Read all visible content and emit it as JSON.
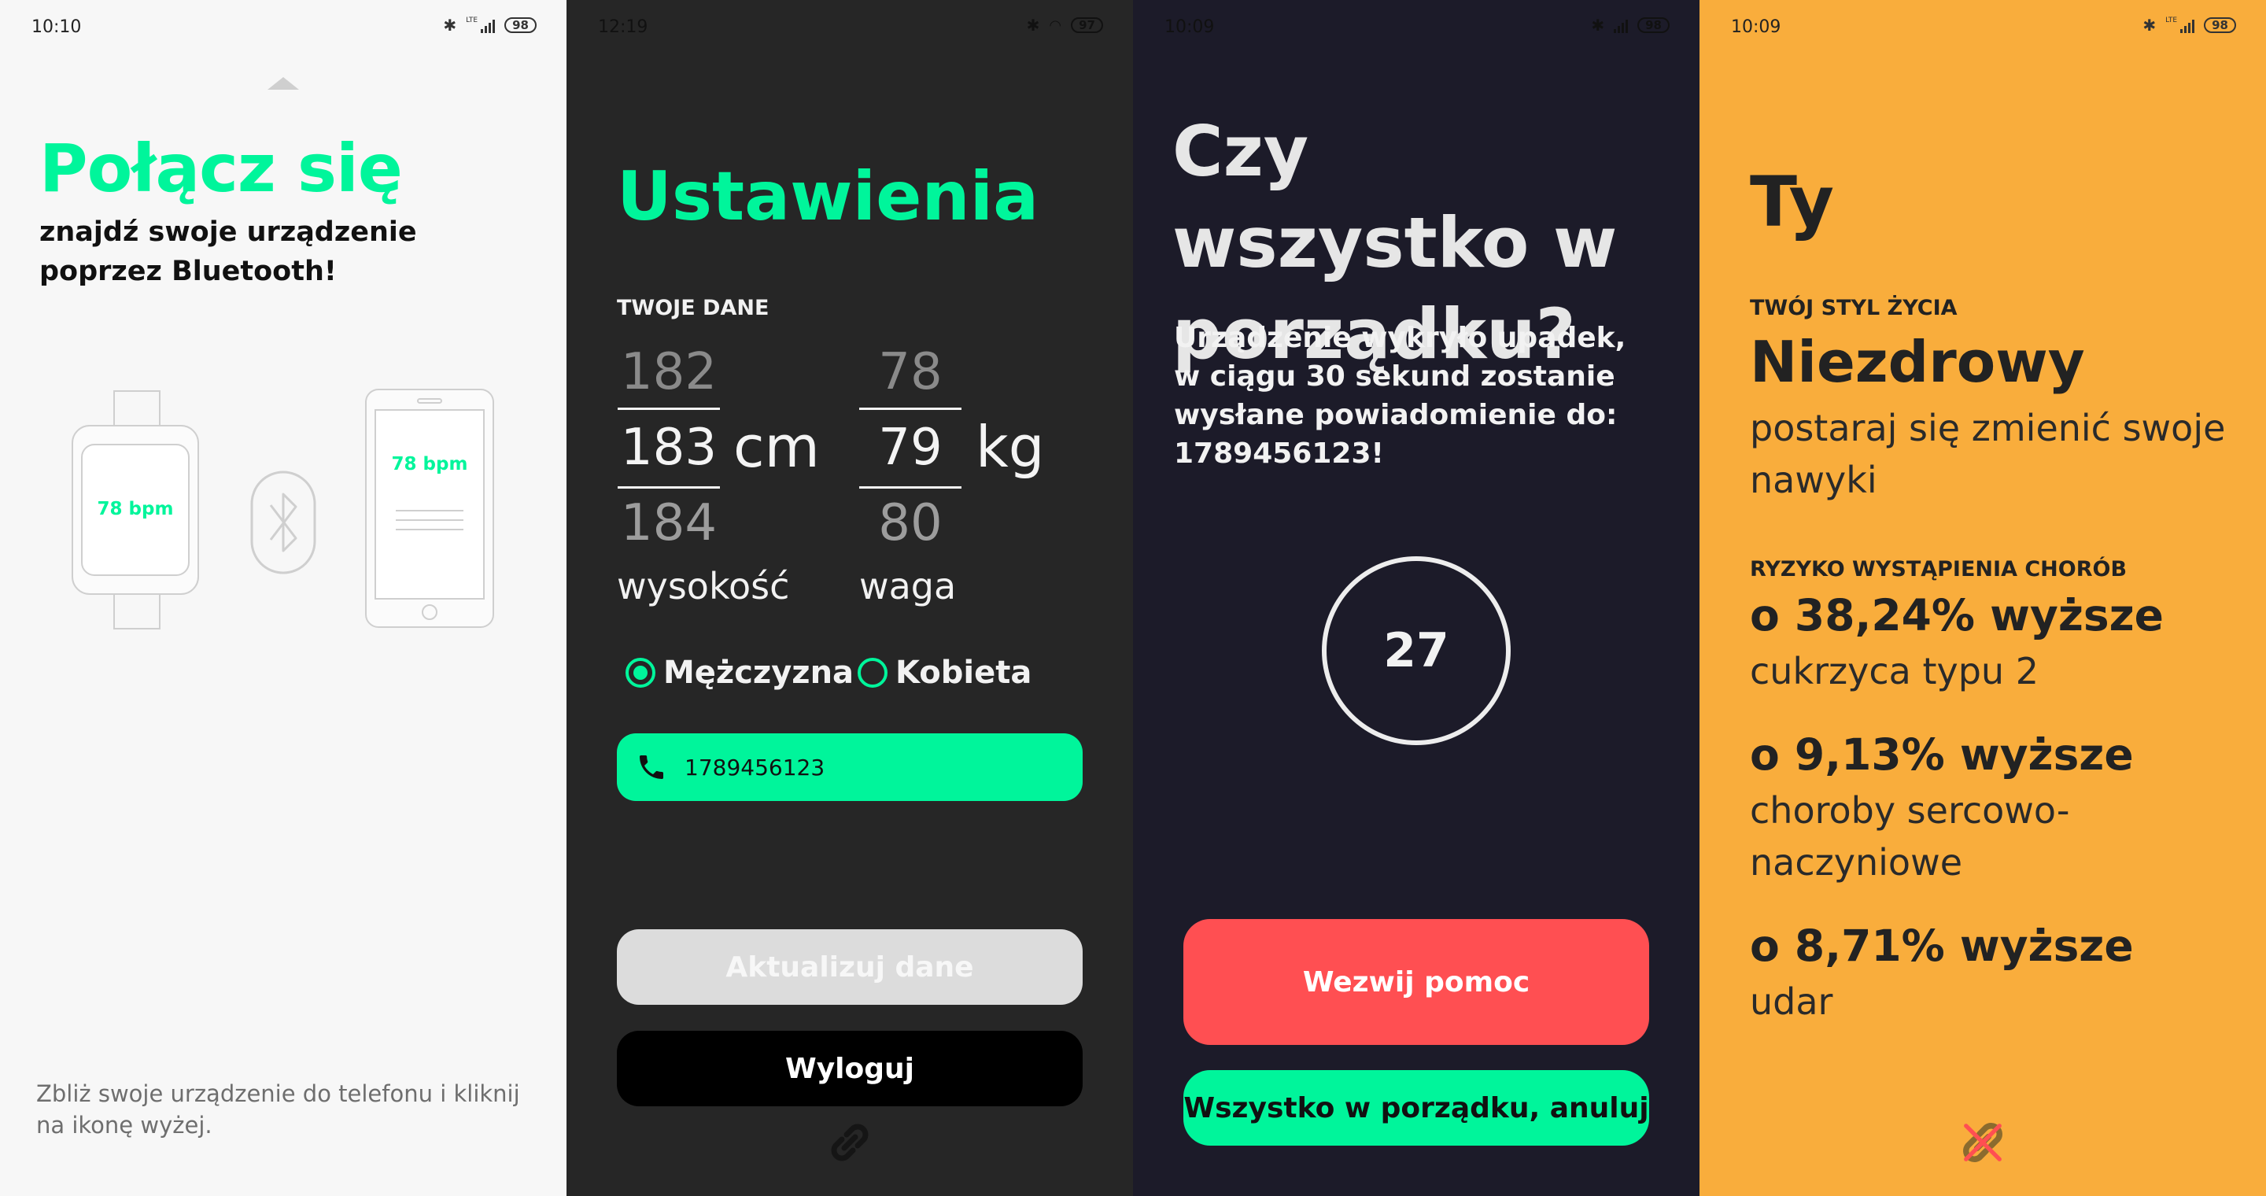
{
  "screens": {
    "connect": {
      "time": "10:10",
      "battery": "98",
      "network": "LTE",
      "title": "Połącz się",
      "subtitle": "znajdź swoje urządzenie poprzez Bluetooth!",
      "watch_bpm": "78 bpm",
      "phone_bpm": "78 bpm",
      "hint": "Zbliż swoje urządzenie do telefonu i kliknij na ikonę wyżej."
    },
    "settings": {
      "time": "12:19",
      "battery": "97",
      "title": "Ustawienia",
      "section": "TWOJE DANE",
      "height_above": "182",
      "height_value": "183",
      "height_below": "184",
      "height_unit": "cm",
      "height_label": "wysokość",
      "weight_above": "78",
      "weight_value": "79",
      "weight_below": "80",
      "weight_unit": "kg",
      "weight_label": "waga",
      "gender_male": "Mężczyzna",
      "gender_female": "Kobieta",
      "selected_gender": "Mężczyzna",
      "phone_number": "1789456123",
      "update_button": "Aktualizuj dane",
      "logout_button": "Wyloguj"
    },
    "alert": {
      "time": "10:09",
      "battery": "98",
      "title": "Czy wszystko w porządku?",
      "message": "Urządzenie wykryło upadek, w ciągu 30 sekund zostanie wysłane powiadomienie do: 1789456123!",
      "countdown": "27",
      "help_button": "Wezwij pomoc",
      "cancel_button": "Wszystko w porządku, anuluj"
    },
    "profile": {
      "time": "10:09",
      "battery": "98",
      "network": "LTE",
      "title": "Ty",
      "lifestyle_label": "TWÓJ STYL ŻYCIA",
      "lifestyle_value": "Niezdrowy",
      "lifestyle_advice": "postaraj się zmienić swoje nawyki",
      "risk_label": "RYZYKO WYSTĄPIENIA CHORÓB",
      "risks": [
        {
          "value": "o 38,24% wyższe",
          "disease": "cukrzyca typu 2"
        },
        {
          "value": "o 9,13% wyższe",
          "disease": "choroby sercowo-naczyniowe"
        },
        {
          "value": "o 8,71% wyższe",
          "disease": "udar"
        }
      ]
    }
  },
  "colors": {
    "accent_green": "#00f59b",
    "danger_red": "#ff4f52",
    "profile_orange": "#f9ad3c",
    "dark_settings": "#262626",
    "dark_alert": "#1c1b29"
  }
}
